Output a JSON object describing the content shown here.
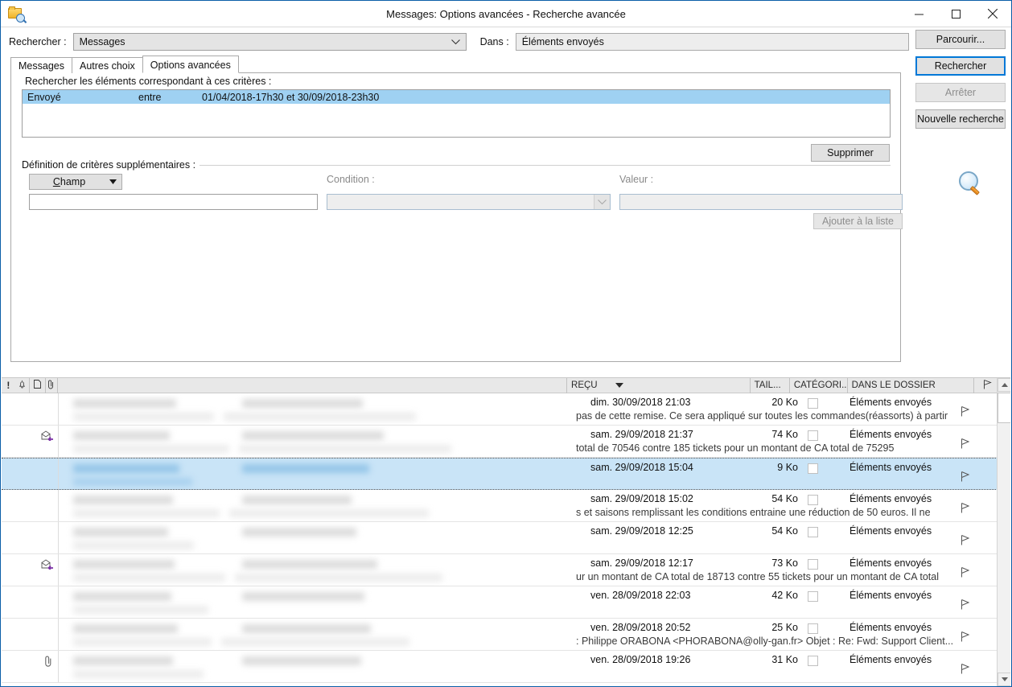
{
  "window": {
    "title": "Messages: Options avancées - Recherche avancée",
    "app_icon": "folder-search-icon",
    "minimize": "minimize-icon",
    "maximize": "maximize-icon",
    "close": "close-icon"
  },
  "search_bar": {
    "look_for_label": "Rechercher :",
    "look_for_value": "Messages",
    "in_label": "Dans :",
    "in_value": "Éléments envoyés"
  },
  "tabs": [
    {
      "label": "Messages",
      "active": false
    },
    {
      "label": "Autres choix",
      "active": false
    },
    {
      "label": "Options avancées",
      "active": true
    }
  ],
  "advanced": {
    "criteria_heading": "Rechercher les éléments correspondant à ces critères :",
    "criteria_rows": [
      {
        "field": "Envoyé",
        "condition": "entre",
        "value": "01/04/2018-17h30 et 30/09/2018-23h30",
        "selected": true
      }
    ],
    "delete_button": "Supprimer",
    "more_criteria_label": "Définition de critères supplémentaires :",
    "field_button": "Champ",
    "field_input_value": "",
    "condition_label": "Condition :",
    "condition_value": "",
    "value_label": "Valeur :",
    "value_input": "",
    "add_to_list_button": "Ajouter à la liste"
  },
  "right_buttons": [
    {
      "label": "Parcourir...",
      "state": "normal"
    },
    {
      "label": "Rechercher",
      "state": "default"
    },
    {
      "label": "Arrêter",
      "state": "disabled"
    },
    {
      "label": "Nouvelle recherche",
      "state": "normal"
    }
  ],
  "magnifier_icon": "magnifying-glass-icon",
  "results": {
    "columns": [
      {
        "label": "!",
        "name": "importance-column"
      },
      {
        "label": "",
        "name": "reminder-column"
      },
      {
        "label": "",
        "name": "icon-column"
      },
      {
        "label": "",
        "name": "attachment-column"
      },
      {
        "label": "REÇU",
        "name": "received-column",
        "sorted": "desc"
      },
      {
        "label": "TAIL...",
        "name": "size-column"
      },
      {
        "label": "CATÉGORI...",
        "name": "categories-column"
      },
      {
        "label": "DANS LE DOSSIER",
        "name": "in-folder-column"
      },
      {
        "label": "",
        "name": "flag-column"
      }
    ],
    "rows": [
      {
        "received": "dim. 30/09/2018 21:03",
        "size": "20 Ko",
        "folder": "Éléments envoyés",
        "snippet": "pas de cette remise.  Ce sera appliqué sur toutes les commandes(réassorts) à partir",
        "icon": "",
        "selected": false
      },
      {
        "received": "sam. 29/09/2018 21:37",
        "size": "74 Ko",
        "folder": "Éléments envoyés",
        "snippet": "total de 70546 contre 185 tickets pour un montant de CA total de 75295",
        "icon": "replied-envelope-icon",
        "selected": false
      },
      {
        "received": "sam. 29/09/2018 15:04",
        "size": "9 Ko",
        "folder": "Éléments envoyés",
        "snippet": "",
        "icon": "",
        "selected": true
      },
      {
        "received": "sam. 29/09/2018 15:02",
        "size": "54 Ko",
        "folder": "Éléments envoyés",
        "snippet": "s et saisons remplissant les conditions entraine une réduction de 50 euros. Il ne",
        "icon": "",
        "selected": false
      },
      {
        "received": "sam. 29/09/2018 12:25",
        "size": "54 Ko",
        "folder": "Éléments envoyés",
        "snippet": "",
        "icon": "",
        "selected": false
      },
      {
        "received": "sam. 29/09/2018 12:17",
        "size": "73 Ko",
        "folder": "Éléments envoyés",
        "snippet": "ur un montant de CA total de 18713 contre 55 tickets pour un montant de CA total",
        "icon": "replied-envelope-icon",
        "selected": false
      },
      {
        "received": "ven. 28/09/2018 22:03",
        "size": "42 Ko",
        "folder": "Éléments envoyés",
        "snippet": "",
        "icon": "",
        "selected": false
      },
      {
        "received": "ven. 28/09/2018 20:52",
        "size": "25 Ko",
        "folder": "Éléments envoyés",
        "snippet": ": Philippe ORABONA <PHORABONA@olly-gan.fr> Objet : Re: Fwd: Support Client...",
        "icon": "",
        "selected": false
      },
      {
        "received": "ven. 28/09/2018 19:26",
        "size": "31 Ko",
        "folder": "Éléments envoyés",
        "snippet": "",
        "icon": "attachment-clip-icon",
        "selected": false
      }
    ]
  },
  "colors": {
    "accent": "#0078d7",
    "selection": "#c9e4f7",
    "criteria_selection": "#9fd1f2",
    "window_border": "#0b5ea8"
  }
}
